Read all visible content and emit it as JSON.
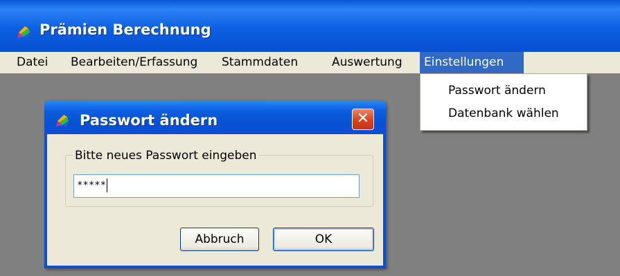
{
  "app": {
    "title": "Prämien Berechnung",
    "icon": "app-colorful-icon"
  },
  "menu": {
    "items": [
      {
        "label": "Datei"
      },
      {
        "label": "Bearbeiten/Erfassung"
      },
      {
        "label": "Stammdaten"
      },
      {
        "label": "Auswertung"
      },
      {
        "label": "Einstellungen",
        "active": true
      }
    ],
    "dropdown": {
      "items": [
        {
          "label": "Passwort ändern"
        },
        {
          "label": "Datenbank wählen"
        }
      ]
    }
  },
  "dialog": {
    "title": "Passwort ändern",
    "close_symbol": "✕",
    "group_label": "Bitte neues Passwort eingeben",
    "password_value": "*****",
    "cancel_label": "Abbruch",
    "ok_label": "OK"
  },
  "colors": {
    "titlebar": "#0a57d6",
    "menu_highlight": "#316ac5",
    "workspace": "#808080",
    "dialog_face": "#ece9d8",
    "close_button": "#d7421a"
  }
}
